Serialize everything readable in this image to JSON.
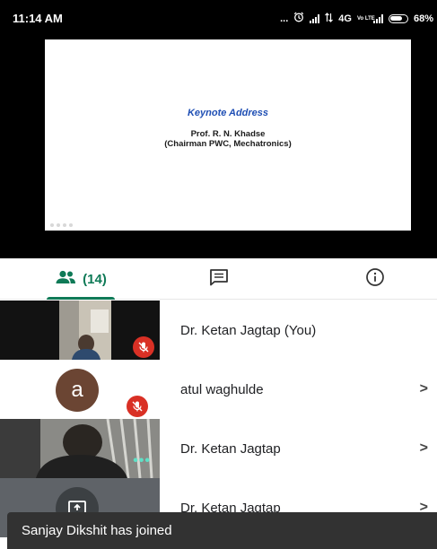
{
  "status_bar": {
    "time": "11:14 AM",
    "dots": "...",
    "network": "4G",
    "volte": "Vo LTE",
    "battery": "68%"
  },
  "slide": {
    "title": "Keynote Address",
    "speaker": "Prof. R. N. Khadse",
    "affiliation": "(Chairman PWC, Mechatronics)"
  },
  "tabs": {
    "people_count": "(14)",
    "people_icon": "people-icon",
    "chat_icon": "chat-icon",
    "info_icon": "info-icon",
    "accent": "#0f7a57"
  },
  "participants": [
    {
      "name": "Dr. Ketan Jagtap (You)",
      "muted": true,
      "avatar_letter": ""
    },
    {
      "name": "atul waghulde",
      "muted": true,
      "avatar_letter": "a",
      "avatar_color": "#6b4533",
      "chevron": ">"
    },
    {
      "name": "Dr. Ketan Jagtap",
      "muted": false,
      "chevron": ">"
    },
    {
      "name": "Dr. Ketan Jagtap",
      "muted": false,
      "chevron": ">"
    }
  ],
  "snackbar": {
    "message": "Sanjay Dikshit has joined"
  },
  "colors": {
    "mute_red": "#d93025",
    "snackbar_bg": "#323232"
  }
}
